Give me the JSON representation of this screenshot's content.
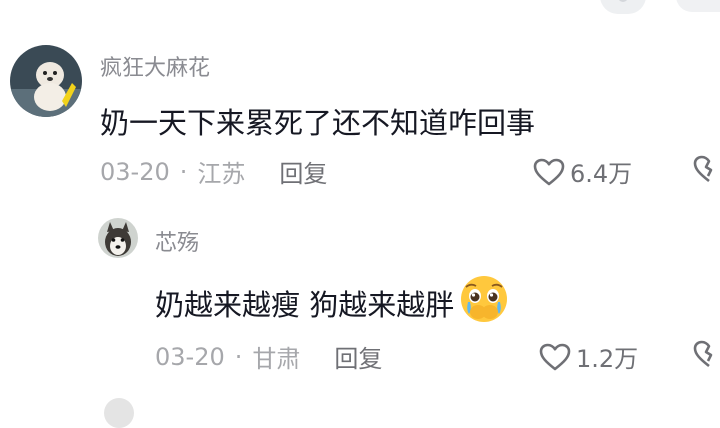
{
  "comments": [
    {
      "username": "疯狂大麻花",
      "text": "奶一天下来累死了还不知道咋回事",
      "date": "03-20",
      "separator": "·",
      "location": "江苏",
      "reply_label": "回复",
      "like_count": "6.4万",
      "avatar_icon": "dog-photo-avatar",
      "like_icon": "heart-outline-icon",
      "dislike_icon": "broken-heart-icon"
    },
    {
      "username": "芯殇",
      "text": "奶越来越瘦 狗越来越胖",
      "emoji": "pleading-face-emoji",
      "date": "03-20",
      "separator": "·",
      "location": "甘肃",
      "reply_label": "回复",
      "like_count": "1.2万",
      "avatar_icon": "husky-photo-avatar",
      "like_icon": "heart-outline-icon",
      "dislike_icon": "broken-heart-icon"
    }
  ],
  "colors": {
    "username": "#8a8b91",
    "content": "#161823",
    "meta": "#a6a7ab",
    "reply": "#6f7075",
    "emoji": "#ffc83d"
  }
}
